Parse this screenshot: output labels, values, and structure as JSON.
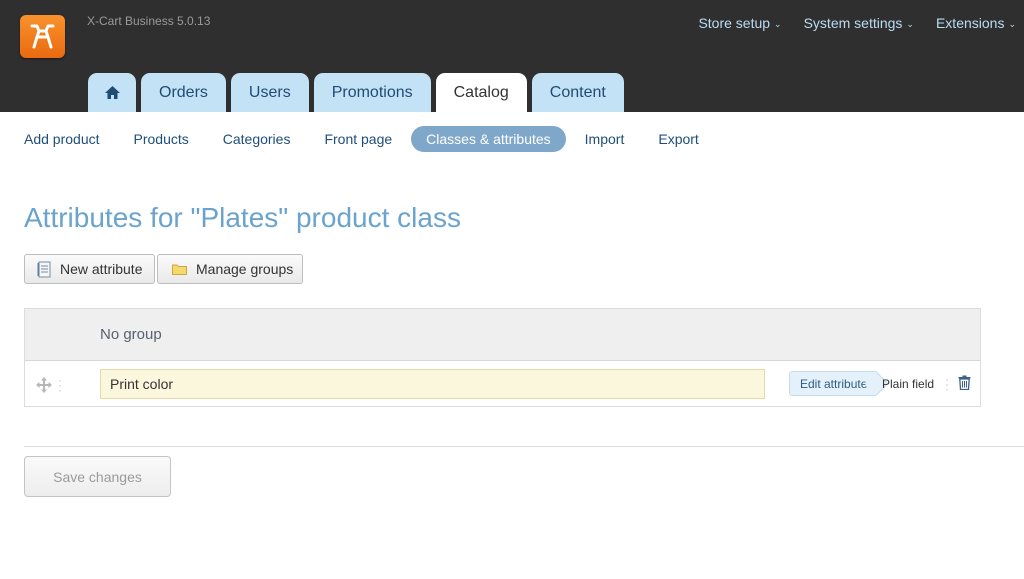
{
  "app": {
    "version": "X-Cart Business 5.0.13"
  },
  "top_menu": [
    {
      "label": "Store setup"
    },
    {
      "label": "System settings"
    },
    {
      "label": "Extensions"
    }
  ],
  "tabs": [
    {
      "label": "Orders"
    },
    {
      "label": "Users"
    },
    {
      "label": "Promotions"
    },
    {
      "label": "Catalog",
      "active": true
    },
    {
      "label": "Content"
    }
  ],
  "subnav": [
    {
      "label": "Add product"
    },
    {
      "label": "Products"
    },
    {
      "label": "Categories"
    },
    {
      "label": "Front page"
    },
    {
      "label": "Classes & attributes",
      "active": true
    },
    {
      "label": "Import"
    },
    {
      "label": "Export"
    }
  ],
  "page": {
    "title": "Attributes for \"Plates\" product class"
  },
  "toolbar": {
    "new_attribute": "New attribute",
    "manage_groups": "Manage groups"
  },
  "group": {
    "name": "No group"
  },
  "attributes": [
    {
      "name": "Print color",
      "edit_label": "Edit attribute",
      "type": "Plain field"
    }
  ],
  "footer": {
    "save_label": "Save changes"
  },
  "colors": {
    "topbar_bg": "#302f2f",
    "tab_bg": "#c4e2f6",
    "active_subnav_bg": "#7fa7c9",
    "title_color": "#6aa4cc",
    "logo_orange": "#f8922c"
  },
  "icons": [
    "cart-logo-icon",
    "chevron-down-icon",
    "home-icon",
    "document-icon",
    "folder-icon",
    "move-icon",
    "trash-icon"
  ]
}
